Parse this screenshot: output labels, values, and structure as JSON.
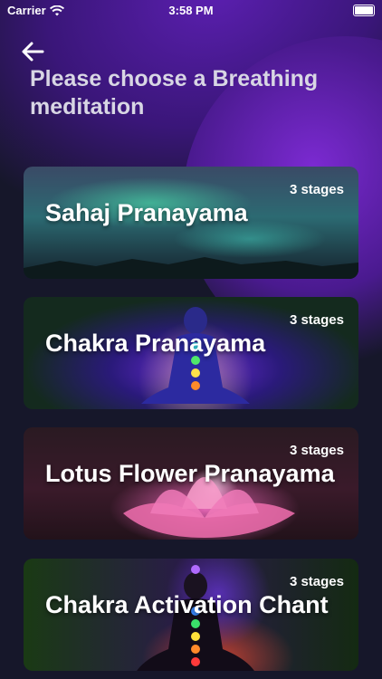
{
  "status_bar": {
    "carrier": "Carrier",
    "time": "3:58 PM"
  },
  "page": {
    "title": "Please choose a Breathing meditation"
  },
  "meditations": [
    {
      "name": "Sahaj Pranayama",
      "stages": "3 stages"
    },
    {
      "name": "Chakra Pranayama",
      "stages": "3 stages"
    },
    {
      "name": "Lotus Flower Pranayama",
      "stages": "3 stages"
    },
    {
      "name": "Chakra Activation Chant",
      "stages": "3 stages"
    }
  ],
  "icons": {
    "back": "arrow-left-icon",
    "wifi": "wifi-icon",
    "battery": "battery-icon"
  }
}
